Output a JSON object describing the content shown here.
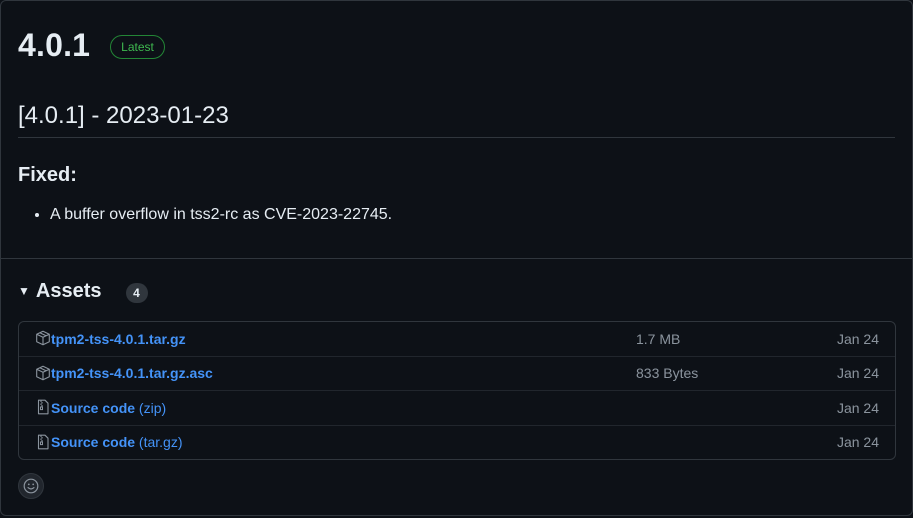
{
  "release": {
    "title": "4.0.1",
    "badge": "Latest",
    "version_heading": "[4.0.1] - 2023-01-23",
    "section_heading": "Fixed:",
    "notes": [
      "A buffer overflow in tss2-rc as CVE-2023-22745."
    ]
  },
  "assets": {
    "title": "Assets",
    "count": "4",
    "items": [
      {
        "name": "tpm2-tss-4.0.1.tar.gz",
        "ext": "",
        "size": "1.7 MB",
        "date": "Jan 24",
        "icon": "package-icon"
      },
      {
        "name": "tpm2-tss-4.0.1.tar.gz.asc",
        "ext": "",
        "size": "833 Bytes",
        "date": "Jan 24",
        "icon": "package-icon"
      },
      {
        "name": "Source code",
        "ext": " (zip)",
        "size": "",
        "date": "Jan 24",
        "icon": "file-zip-icon"
      },
      {
        "name": "Source code",
        "ext": " (tar.gz)",
        "size": "",
        "date": "Jan 24",
        "icon": "file-zip-icon"
      }
    ]
  },
  "colors": {
    "background": "#0d1117",
    "text": "#e6edf3",
    "link": "#4493f8",
    "muted": "#8b949e",
    "latest_green": "#3fb950",
    "border": "#30363d"
  },
  "reaction": {
    "icon": "smiley-icon"
  }
}
